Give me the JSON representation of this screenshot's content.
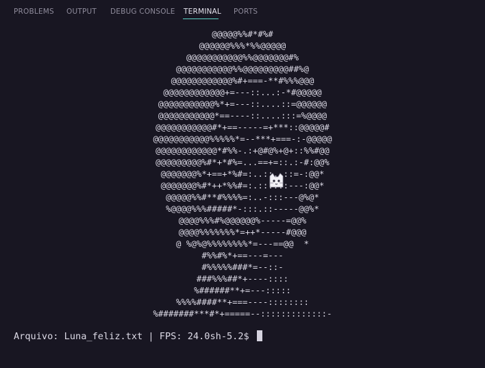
{
  "tabs": [
    {
      "label": "PROBLEMS"
    },
    {
      "label": "OUTPUT"
    },
    {
      "label": "DEBUG CONSOLE"
    },
    {
      "label": "TERMINAL",
      "active": true
    },
    {
      "label": "PORTS"
    }
  ],
  "terminal": {
    "art_lines": [
      "@@@@@%%#*#%#",
      "@@@@@@%%%*%%@@@@@",
      "@@@@@@@@@@@%%@@@@@@@#%",
      "@@@@@@@@@@@%%@@@@@@@@@##%@",
      "@@@@@@@@@@@@%#+===-**#%%%@@@",
      "@@@@@@@@@@@@+=---::...:-*#@@@@@",
      "@@@@@@@@@@@%*+=---::....::=@@@@@@",
      "@@@@@@@@@@@*==----::....:::=%@@@@",
      "@@@@@@@@@@@#*+==-----=+***::@@@@@#",
      "@@@@@@@@@@@%%%%%*=--***+===-:-@@@@@",
      "@@@@@@@@@@@@*#%%-.:+@#@%+@+::%%#@@",
      "@@@@@@@@@%#*+*#%=...==+=::.:-#:@@%",
      "@@@@@@@%*+==+*%#=:..::..::=-:@@*",
      "@@@@@@@%#*++*%%#=:.::::::---:@@*",
      "@@@@@%%#**#%%%%=:..-:::---@%@*",
      "%@@@@%%%#####*-:::.::-----@@%*",
      "@@@@%%%#%@@@@@@%-----=@@%",
      "@@@@%%%%%%%*=++*-----#@@@",
      "@ %@%@%%%%%%%%*=---==@@  *",
      "#%%#%*+==---=---",
      "#%%%%%###*=--::-",
      "###%%%##*+----::::",
      "%######**+=---:::::",
      "%%%%####**+===----::::::::",
      "%#######***#*+=====--:::::::::::::-"
    ],
    "prompt": "Arquivo: Luna_feliz.txt | FPS: 24.0sh-5.2$ "
  },
  "colors": {
    "background": "#181622",
    "text": "#dcdae6",
    "tab_inactive": "#8f8c9c",
    "tab_active": "#e6e4ee",
    "accent": "#5fd3c6"
  },
  "icons": {
    "cat": "cat-face-icon"
  }
}
